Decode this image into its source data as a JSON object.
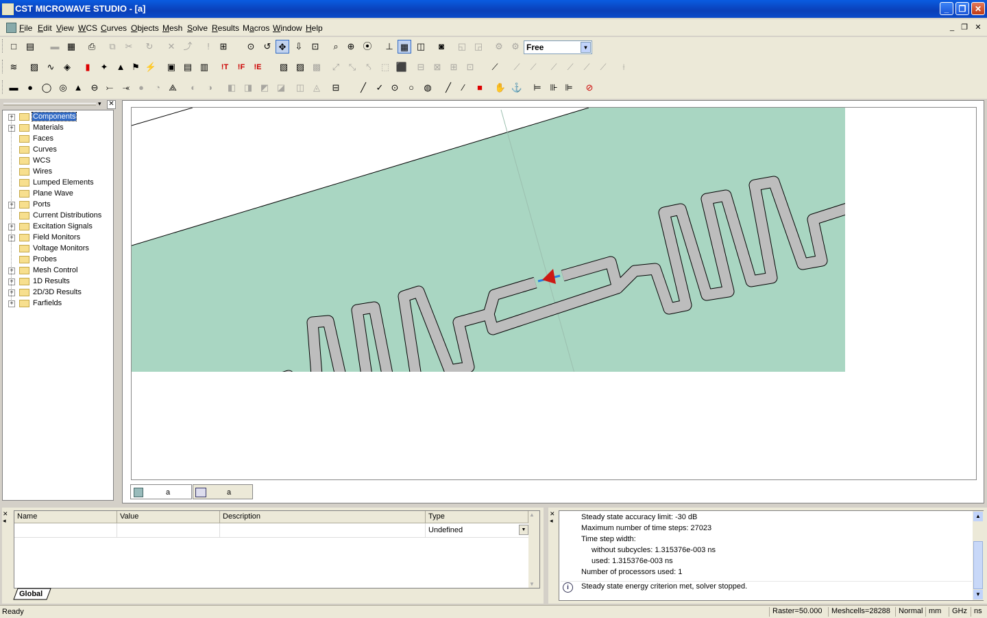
{
  "window": {
    "title": "CST MICROWAVE STUDIO - [a]"
  },
  "menu": {
    "items": [
      {
        "label": "File",
        "ul": "F",
        "rest": "ile"
      },
      {
        "label": "Edit",
        "ul": "E",
        "rest": "dit"
      },
      {
        "label": "View",
        "ul": "V",
        "rest": "iew"
      },
      {
        "label": "WCS",
        "ul": "W",
        "rest": "CS"
      },
      {
        "label": "Curves",
        "ul": "C",
        "rest": "urves"
      },
      {
        "label": "Objects",
        "ul": "O",
        "rest": "bjects"
      },
      {
        "label": "Mesh",
        "ul": "M",
        "rest": "esh"
      },
      {
        "label": "Solve",
        "ul": "S",
        "rest": "olve"
      },
      {
        "label": "Results",
        "ul": "R",
        "rest": "esults"
      },
      {
        "label": "Macros",
        "ul": "a",
        "pre": "M",
        "rest": "cros"
      },
      {
        "label": "Window",
        "ul": "W",
        "rest": "indow"
      },
      {
        "label": "Help",
        "ul": "H",
        "rest": "elp"
      }
    ]
  },
  "toolbar": {
    "view_mode": "Free"
  },
  "tree": {
    "items": [
      {
        "label": "Components",
        "expandable": true,
        "selected": true
      },
      {
        "label": "Materials",
        "expandable": true
      },
      {
        "label": "Faces",
        "expandable": false
      },
      {
        "label": "Curves",
        "expandable": false
      },
      {
        "label": "WCS",
        "expandable": false
      },
      {
        "label": "Wires",
        "expandable": false
      },
      {
        "label": "Lumped Elements",
        "expandable": false
      },
      {
        "label": "Plane Wave",
        "expandable": false
      },
      {
        "label": "Ports",
        "expandable": true
      },
      {
        "label": "Current Distributions",
        "expandable": false
      },
      {
        "label": "Excitation Signals",
        "expandable": true
      },
      {
        "label": "Field Monitors",
        "expandable": true
      },
      {
        "label": "Voltage Monitors",
        "expandable": false
      },
      {
        "label": "Probes",
        "expandable": false
      },
      {
        "label": "Mesh Control",
        "expandable": true
      },
      {
        "label": "1D Results",
        "expandable": true
      },
      {
        "label": "2D/3D Results",
        "expandable": true
      },
      {
        "label": "Farfields",
        "expandable": true
      }
    ]
  },
  "view_tabs": [
    {
      "label": "a"
    },
    {
      "label": "a"
    }
  ],
  "params": {
    "columns": [
      "Name",
      "Value",
      "Description",
      "Type"
    ],
    "row_type": "Undefined",
    "tab": "Global"
  },
  "messages": {
    "lines": [
      "Steady state accuracy limit: -30 dB",
      "Maximum number of time steps: 27023",
      "Time step width:",
      "without subcycles: 1.315376e-003 ns",
      "used: 1.315376e-003 ns",
      "Number of processors used: 1"
    ],
    "info": "Steady state energy criterion met, solver stopped."
  },
  "status": {
    "state": "Ready",
    "raster": "Raster=50.000",
    "meshcells": "Meshcells=28288",
    "mode": "Normal",
    "length_unit": "mm",
    "freq_unit": "GHz",
    "time_unit": "ns"
  },
  "colors": {
    "substrate": "#a9d6c2",
    "strip": "#bdbdbd",
    "port": "#cc1a14",
    "titlebar": "#0a49c9",
    "selection": "#316ac5"
  }
}
